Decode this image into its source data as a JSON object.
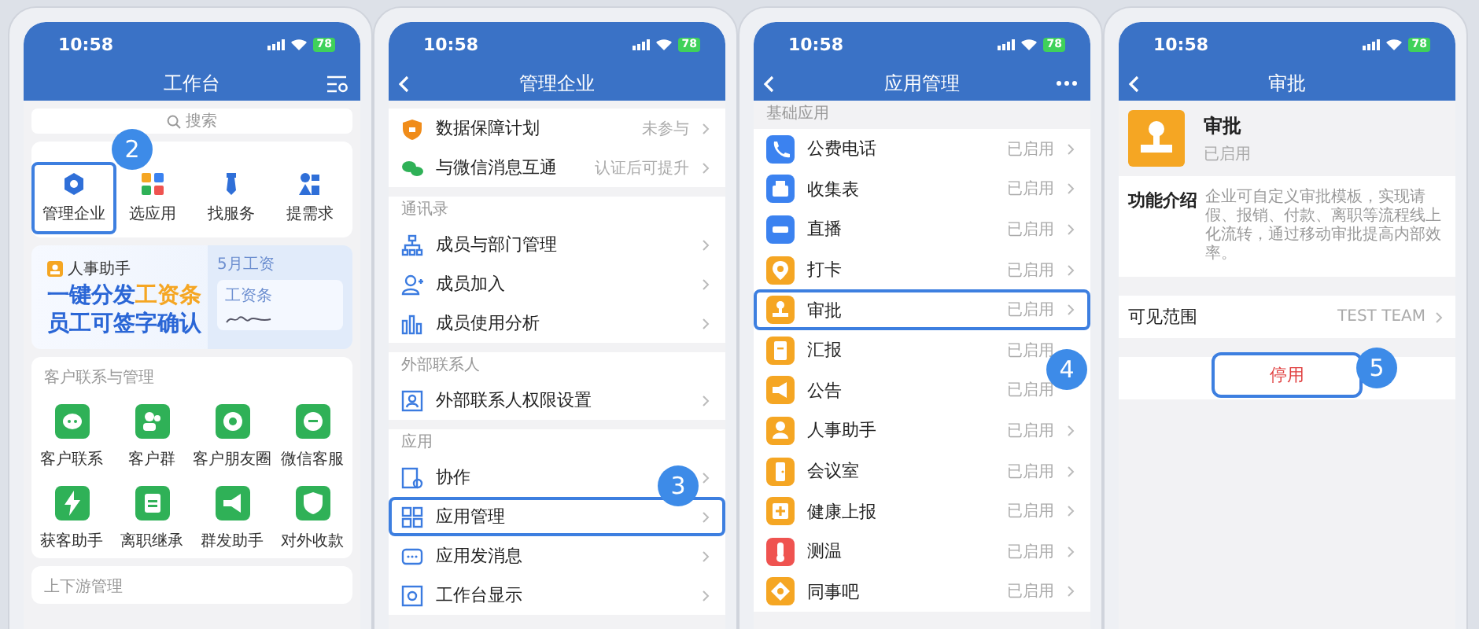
{
  "screens": [
    {
      "kind": "workbench",
      "time": "10:58",
      "battery": "78",
      "title": "工作台",
      "step": "2",
      "search": {
        "placeholder": "搜索"
      },
      "shortcuts": [
        {
          "label": "管理企业",
          "highlighted": true
        },
        {
          "label": "选应用",
          "highlighted": false
        },
        {
          "label": "找服务",
          "highlighted": false
        },
        {
          "label": "提需求",
          "highlighted": false
        }
      ],
      "banner": {
        "tag": "人事助手",
        "lines": [
          [
            {
              "text": "一键分发",
              "accent": false
            },
            {
              "text": "工资条",
              "accent": true
            }
          ],
          [
            {
              "text": "员工可签字确认",
              "accent": false
            }
          ]
        ],
        "card_title": "5月工资",
        "slip_title": "工资条"
      },
      "sections": [
        {
          "title": "客户联系与管理",
          "apps": [
            "客户联系",
            "客户群",
            "客户朋友圈",
            "微信客服",
            "获客助手",
            "离职继承",
            "群发助手",
            "对外收款"
          ]
        },
        {
          "title": "上下游管理"
        }
      ]
    },
    {
      "kind": "settings",
      "time": "10:58",
      "battery": "78",
      "title": "管理企业",
      "step": "3",
      "groups": [
        {
          "rows": [
            {
              "label": "数据保障计划",
              "value": "未参与",
              "highlighted": false
            },
            {
              "label": "与微信消息互通",
              "value": "认证后可提升",
              "highlighted": false
            }
          ]
        },
        {
          "title": "通讯录",
          "rows": [
            {
              "label": "成员与部门管理",
              "highlighted": false
            },
            {
              "label": "成员加入",
              "highlighted": false
            },
            {
              "label": "成员使用分析",
              "highlighted": false
            }
          ]
        },
        {
          "title": "外部联系人",
          "rows": [
            {
              "label": "外部联系人权限设置",
              "highlighted": false
            }
          ]
        },
        {
          "title": "应用",
          "rows": [
            {
              "label": "协作",
              "highlighted": false
            },
            {
              "label": "应用管理",
              "highlighted": true
            },
            {
              "label": "应用发消息",
              "highlighted": false
            },
            {
              "label": "工作台显示",
              "highlighted": false
            }
          ]
        }
      ]
    },
    {
      "kind": "app_list",
      "time": "10:58",
      "battery": "78",
      "title": "应用管理",
      "step": "4",
      "section": "基础应用",
      "apps": [
        {
          "label": "公费电话",
          "value": "已启用",
          "color": "#3b82f0",
          "highlighted": false
        },
        {
          "label": "收集表",
          "value": "已启用",
          "color": "#3b82f0",
          "highlighted": false
        },
        {
          "label": "直播",
          "value": "已启用",
          "color": "#3b82f0",
          "highlighted": false
        },
        {
          "label": "打卡",
          "value": "已启用",
          "color": "#f5a623",
          "highlighted": false
        },
        {
          "label": "审批",
          "value": "已启用",
          "color": "#f5a623",
          "highlighted": true
        },
        {
          "label": "汇报",
          "value": "已启用",
          "color": "#f5a623",
          "highlighted": false
        },
        {
          "label": "公告",
          "value": "已启用",
          "color": "#f5a623",
          "highlighted": false
        },
        {
          "label": "人事助手",
          "value": "已启用",
          "color": "#f5a623",
          "highlighted": false
        },
        {
          "label": "会议室",
          "value": "已启用",
          "color": "#f5a623",
          "highlighted": false
        },
        {
          "label": "健康上报",
          "value": "已启用",
          "color": "#f5a623",
          "highlighted": false
        },
        {
          "label": "测温",
          "value": "已启用",
          "color": "#ef5350",
          "highlighted": false
        },
        {
          "label": "同事吧",
          "value": "已启用",
          "color": "#f5a623",
          "highlighted": false
        }
      ]
    },
    {
      "kind": "app_detail",
      "time": "10:58",
      "battery": "78",
      "title": "审批",
      "step": "5",
      "app": {
        "name": "审批",
        "status": "已启用"
      },
      "intro": {
        "label": "功能介绍",
        "text": "企业可自定义审批模板，实现请假、报销、付款、离职等流程线上化流转，通过移动审批提高内部效率。"
      },
      "scope": {
        "label": "可见范围",
        "value": "TEST TEAM"
      },
      "action": {
        "label": "停用",
        "highlighted": true
      }
    }
  ]
}
